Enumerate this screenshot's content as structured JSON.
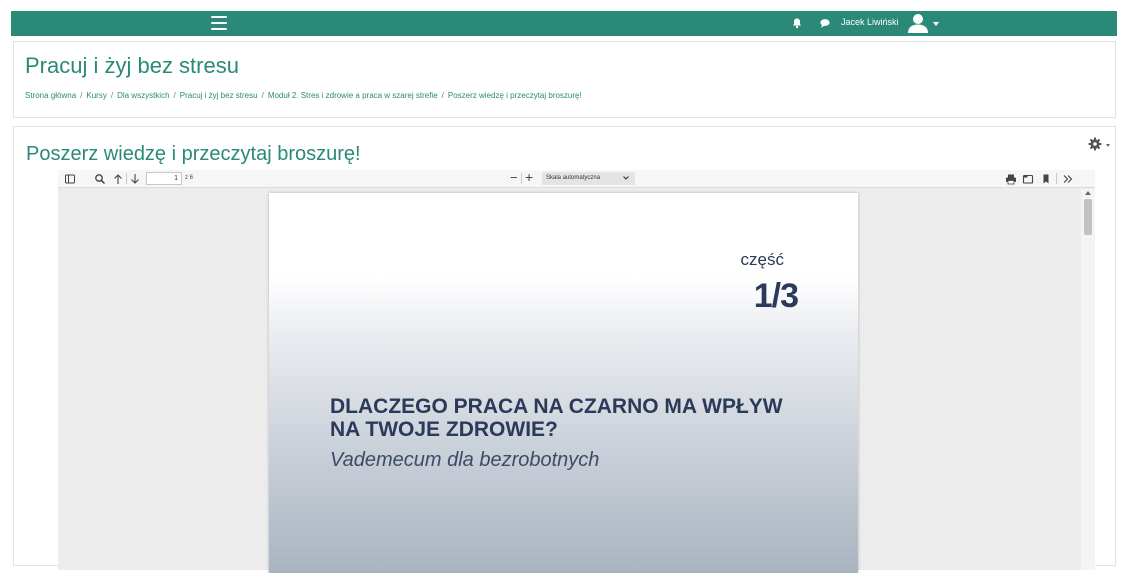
{
  "topbar": {
    "user_name": "Jacek Liwiński",
    "icons": [
      "menu-icon",
      "bell-icon",
      "chat-icon",
      "avatar-icon",
      "caret-down-icon"
    ]
  },
  "header": {
    "title": "Pracuj i żyj bez stresu",
    "breadcrumb": [
      "Strona główna",
      "Kursy",
      "Dla wszystkich",
      "Pracuj i żyj bez stresu",
      "Moduł 2. Stres i zdrowie a praca w szarej strefie",
      "Poszerz wiedzę i przeczytaj broszurę!"
    ],
    "separator": "/"
  },
  "section": {
    "title": "Poszerz wiedzę i przeczytaj broszurę!"
  },
  "pdf_viewer": {
    "current_page": "1",
    "total_pages": "z 6",
    "zoom_label": "Skala automatyczna",
    "zoom_minus": "−",
    "zoom_plus": "+",
    "page": {
      "part_label": "część",
      "part_number": "1/3",
      "heading_line1": "DLACZEGO PRACA NA CZARNO MA WPŁYW",
      "heading_line2": "NA TWOJE ZDROWIE?",
      "subtitle": "Vademecum dla bezrobotnych"
    }
  },
  "colors": {
    "brand": "#2a8a77",
    "document_text": "#2b3a5a"
  }
}
